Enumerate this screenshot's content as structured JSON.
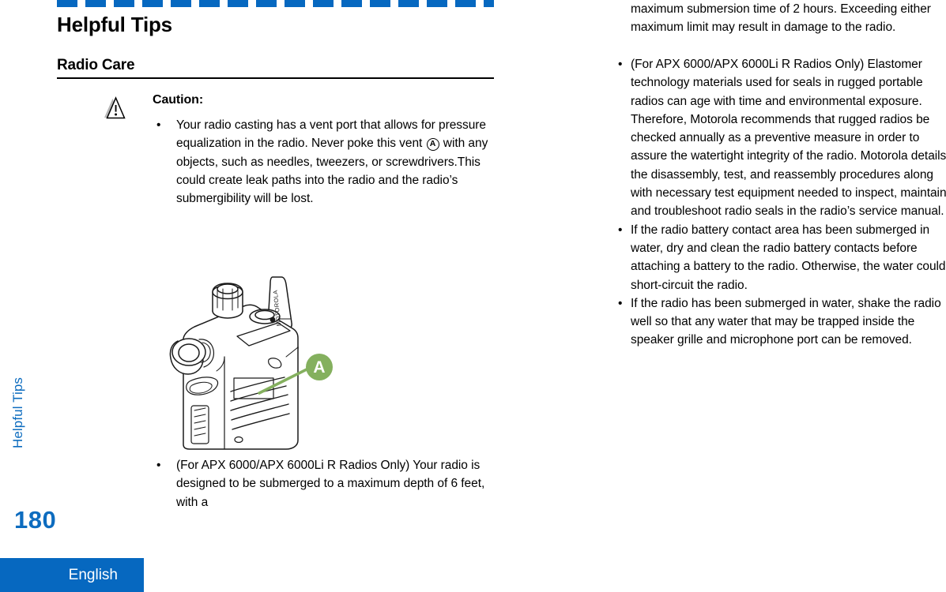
{
  "colors": {
    "brand_blue": "#0668c0",
    "side_tab_blue": "#0d6cbf",
    "callout_green": "#84b05e",
    "text_black": "#000000"
  },
  "header": {
    "page_title": "Helpful Tips",
    "section_heading": "Radio Care"
  },
  "side_tab": {
    "label": "Helpful Tips",
    "page_number": "180",
    "language": "English"
  },
  "caution": {
    "icon_name": "warning-triangle-icon",
    "title": "Caution:",
    "bullets": [
      {
        "before": "Your radio casting has a vent port that allows for pressure equalization in the radio. Never poke this vent ",
        "circled": "A",
        "after": " with any objects, such as needles, tweezers, or screwdrivers.This could create leak paths into the radio and the radio’s submergibility will be lost."
      }
    ]
  },
  "figure": {
    "name": "apx-radio-vent-port-illustration",
    "callout_letter": "A",
    "antenna_brand": "MOTOROLA"
  },
  "left_bottom_bullets": [
    "(For APX 6000/APX 6000Li R Radios Only) Your radio is designed to be submerged to a maximum depth of 6 feet, with a"
  ],
  "right_column": {
    "intro": "maximum submersion time of 2 hours. Exceeding either maximum limit may result in damage to the radio.",
    "bullets": [
      "(For APX 6000/APX 6000Li R Radios Only) Elastomer technology materials used for seals in rugged portable radios can age with time and environmental exposure. Therefore, Motorola recommends that rugged radios be checked annually as a preventive measure in order to assure the watertight integrity of the radio. Motorola details the disassembly, test, and reassembly procedures along with necessary test equipment needed to inspect, maintain and troubleshoot radio seals in the radio’s service manual.",
      "If the radio battery contact area has been submerged in water, dry and clean the radio battery contacts before attaching a battery to the radio. Otherwise, the water could short-circuit the radio.",
      "If the radio has been submerged in water, shake the radio well so that any water that may be trapped inside the speaker grille and microphone port can be removed."
    ]
  },
  "bullet_glyph": "•"
}
